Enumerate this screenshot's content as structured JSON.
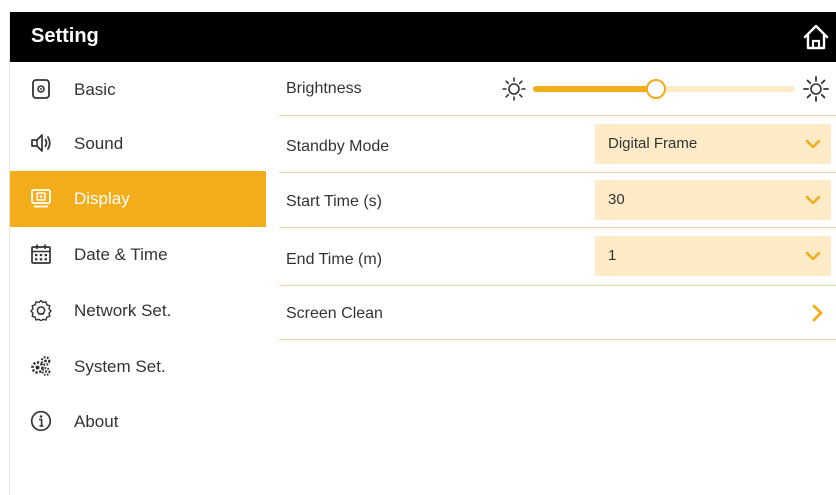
{
  "header": {
    "title": "Setting",
    "home_icon": "home-icon"
  },
  "sidebar": {
    "items": [
      {
        "label": "Basic",
        "icon": "basic-icon",
        "active": false
      },
      {
        "label": "Sound",
        "icon": "speaker-icon",
        "active": false
      },
      {
        "label": "Display",
        "icon": "display-icon",
        "active": true
      },
      {
        "label": "Date & Time",
        "icon": "calendar-icon",
        "active": false
      },
      {
        "label": "Network Set.",
        "icon": "network-gear-icon",
        "active": false
      },
      {
        "label": "System Set.",
        "icon": "gears-icon",
        "active": false
      },
      {
        "label": "About",
        "icon": "info-icon",
        "active": false
      }
    ]
  },
  "display_settings": {
    "brightness": {
      "label": "Brightness",
      "level_fraction": 0.47
    },
    "standby_mode": {
      "label": "Standby Mode",
      "value": "Digital Frame"
    },
    "start_time": {
      "label": "Start Time (s)",
      "value": "30"
    },
    "end_time": {
      "label": "End Time (m)",
      "value": "1"
    },
    "screen_clean": {
      "label": "Screen Clean"
    }
  },
  "colors": {
    "accent": "#f3ad1a",
    "select_bg": "#fdebc8",
    "header_bg": "#000000"
  }
}
